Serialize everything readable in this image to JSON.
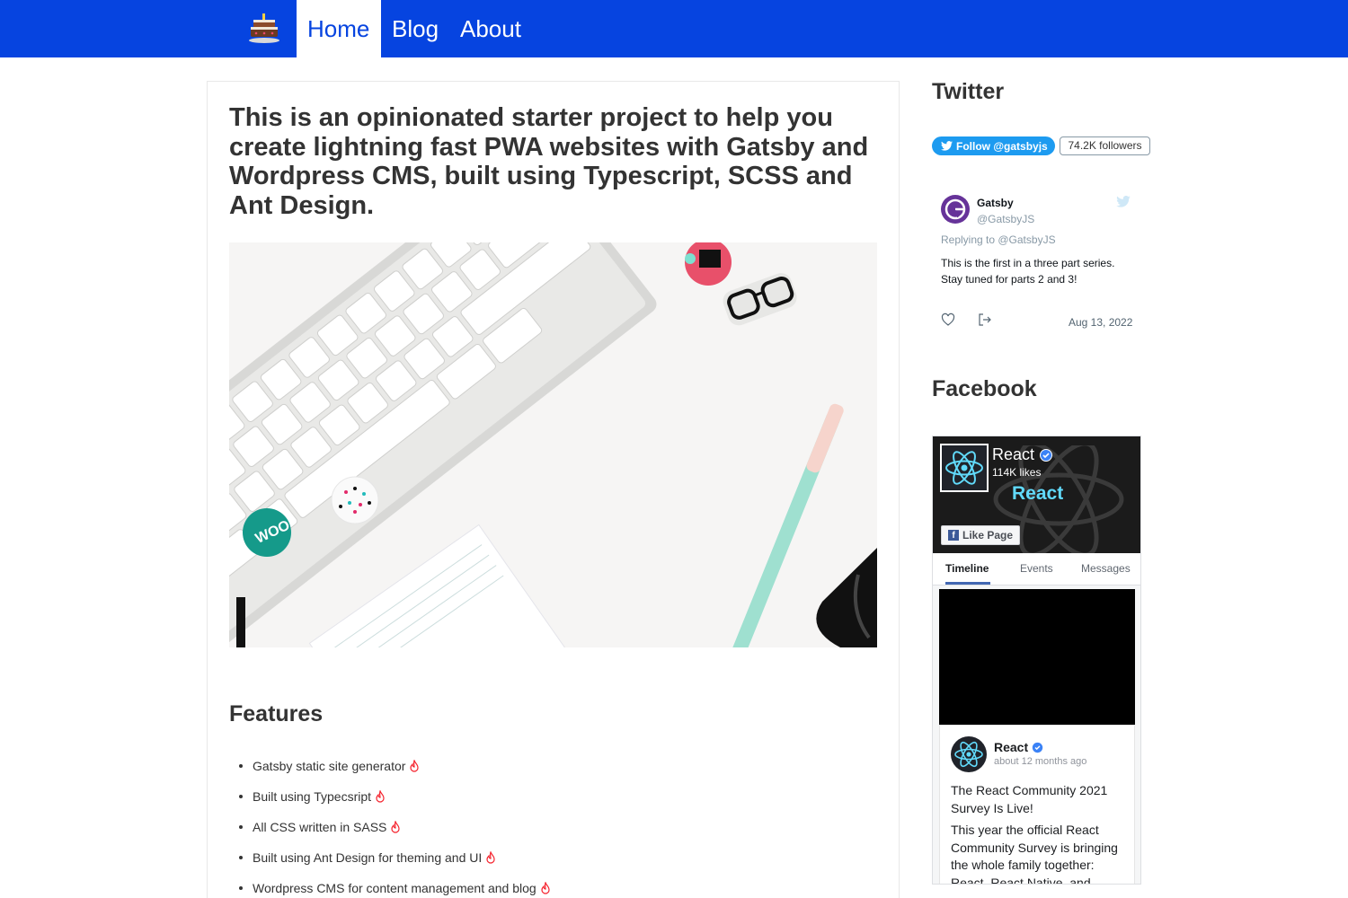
{
  "nav": {
    "logo_icon": "cake-icon",
    "items": [
      {
        "label": "Home",
        "active": true
      },
      {
        "label": "Blog",
        "active": false
      },
      {
        "label": "About",
        "active": false
      }
    ],
    "color": "#0644e0"
  },
  "main": {
    "headline": "This is an opinionated starter project to help you create lightning fast PWA websites with Gatsby and Wordpress CMS, built using Typescript, SCSS and Ant Design.",
    "features_title": "Features",
    "features": [
      "Gatsby static site generator",
      "Built using Typecsript",
      "All CSS written in SASS",
      "Built using Ant Design for theming and UI",
      "Wordpress CMS for content management and blog"
    ],
    "feature_icon": "fire-icon"
  },
  "sidebar": {
    "twitter": {
      "title": "Twitter",
      "follow_label": "Follow @gatsbyjs",
      "followers": "74.2K followers",
      "tweet": {
        "name": "Gatsby",
        "handle": "@GatsbyJS",
        "replying": "Replying to @GatsbyJS",
        "text": "This is the first in a three part series. Stay tuned for parts 2 and 3!",
        "date": "Aug 13, 2022"
      }
    },
    "facebook": {
      "title": "Facebook",
      "page_name": "React",
      "likes": "114K likes",
      "cover_word": "React",
      "like_button": "Like Page",
      "tabs": [
        "Timeline",
        "Events",
        "Messages"
      ],
      "post": {
        "name": "React",
        "time": "about 12 months ago",
        "title": "The React Community 2021 Survey Is Live!",
        "body": "This year the official React Community Survey is bringing the whole family together: React, React Native, and"
      }
    }
  }
}
